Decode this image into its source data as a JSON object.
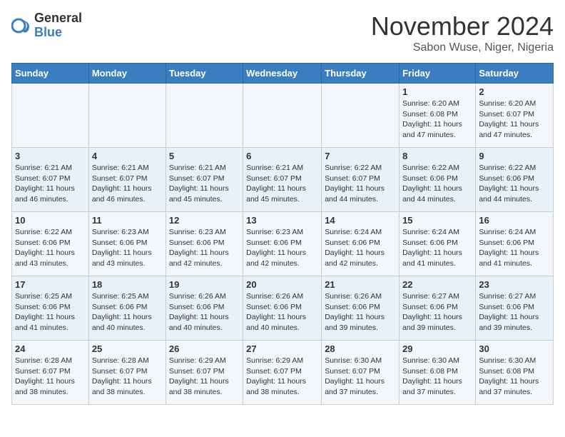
{
  "logo": {
    "general": "General",
    "blue": "Blue"
  },
  "title": "November 2024",
  "location": "Sabon Wuse, Niger, Nigeria",
  "weekdays": [
    "Sunday",
    "Monday",
    "Tuesday",
    "Wednesday",
    "Thursday",
    "Friday",
    "Saturday"
  ],
  "weeks": [
    [
      {
        "day": "",
        "info": ""
      },
      {
        "day": "",
        "info": ""
      },
      {
        "day": "",
        "info": ""
      },
      {
        "day": "",
        "info": ""
      },
      {
        "day": "",
        "info": ""
      },
      {
        "day": "1",
        "info": "Sunrise: 6:20 AM\nSunset: 6:08 PM\nDaylight: 11 hours and 47 minutes."
      },
      {
        "day": "2",
        "info": "Sunrise: 6:20 AM\nSunset: 6:07 PM\nDaylight: 11 hours and 47 minutes."
      }
    ],
    [
      {
        "day": "3",
        "info": "Sunrise: 6:21 AM\nSunset: 6:07 PM\nDaylight: 11 hours and 46 minutes."
      },
      {
        "day": "4",
        "info": "Sunrise: 6:21 AM\nSunset: 6:07 PM\nDaylight: 11 hours and 46 minutes."
      },
      {
        "day": "5",
        "info": "Sunrise: 6:21 AM\nSunset: 6:07 PM\nDaylight: 11 hours and 45 minutes."
      },
      {
        "day": "6",
        "info": "Sunrise: 6:21 AM\nSunset: 6:07 PM\nDaylight: 11 hours and 45 minutes."
      },
      {
        "day": "7",
        "info": "Sunrise: 6:22 AM\nSunset: 6:07 PM\nDaylight: 11 hours and 44 minutes."
      },
      {
        "day": "8",
        "info": "Sunrise: 6:22 AM\nSunset: 6:06 PM\nDaylight: 11 hours and 44 minutes."
      },
      {
        "day": "9",
        "info": "Sunrise: 6:22 AM\nSunset: 6:06 PM\nDaylight: 11 hours and 44 minutes."
      }
    ],
    [
      {
        "day": "10",
        "info": "Sunrise: 6:22 AM\nSunset: 6:06 PM\nDaylight: 11 hours and 43 minutes."
      },
      {
        "day": "11",
        "info": "Sunrise: 6:23 AM\nSunset: 6:06 PM\nDaylight: 11 hours and 43 minutes."
      },
      {
        "day": "12",
        "info": "Sunrise: 6:23 AM\nSunset: 6:06 PM\nDaylight: 11 hours and 42 minutes."
      },
      {
        "day": "13",
        "info": "Sunrise: 6:23 AM\nSunset: 6:06 PM\nDaylight: 11 hours and 42 minutes."
      },
      {
        "day": "14",
        "info": "Sunrise: 6:24 AM\nSunset: 6:06 PM\nDaylight: 11 hours and 42 minutes."
      },
      {
        "day": "15",
        "info": "Sunrise: 6:24 AM\nSunset: 6:06 PM\nDaylight: 11 hours and 41 minutes."
      },
      {
        "day": "16",
        "info": "Sunrise: 6:24 AM\nSunset: 6:06 PM\nDaylight: 11 hours and 41 minutes."
      }
    ],
    [
      {
        "day": "17",
        "info": "Sunrise: 6:25 AM\nSunset: 6:06 PM\nDaylight: 11 hours and 41 minutes."
      },
      {
        "day": "18",
        "info": "Sunrise: 6:25 AM\nSunset: 6:06 PM\nDaylight: 11 hours and 40 minutes."
      },
      {
        "day": "19",
        "info": "Sunrise: 6:26 AM\nSunset: 6:06 PM\nDaylight: 11 hours and 40 minutes."
      },
      {
        "day": "20",
        "info": "Sunrise: 6:26 AM\nSunset: 6:06 PM\nDaylight: 11 hours and 40 minutes."
      },
      {
        "day": "21",
        "info": "Sunrise: 6:26 AM\nSunset: 6:06 PM\nDaylight: 11 hours and 39 minutes."
      },
      {
        "day": "22",
        "info": "Sunrise: 6:27 AM\nSunset: 6:06 PM\nDaylight: 11 hours and 39 minutes."
      },
      {
        "day": "23",
        "info": "Sunrise: 6:27 AM\nSunset: 6:06 PM\nDaylight: 11 hours and 39 minutes."
      }
    ],
    [
      {
        "day": "24",
        "info": "Sunrise: 6:28 AM\nSunset: 6:07 PM\nDaylight: 11 hours and 38 minutes."
      },
      {
        "day": "25",
        "info": "Sunrise: 6:28 AM\nSunset: 6:07 PM\nDaylight: 11 hours and 38 minutes."
      },
      {
        "day": "26",
        "info": "Sunrise: 6:29 AM\nSunset: 6:07 PM\nDaylight: 11 hours and 38 minutes."
      },
      {
        "day": "27",
        "info": "Sunrise: 6:29 AM\nSunset: 6:07 PM\nDaylight: 11 hours and 38 minutes."
      },
      {
        "day": "28",
        "info": "Sunrise: 6:30 AM\nSunset: 6:07 PM\nDaylight: 11 hours and 37 minutes."
      },
      {
        "day": "29",
        "info": "Sunrise: 6:30 AM\nSunset: 6:08 PM\nDaylight: 11 hours and 37 minutes."
      },
      {
        "day": "30",
        "info": "Sunrise: 6:30 AM\nSunset: 6:08 PM\nDaylight: 11 hours and 37 minutes."
      }
    ]
  ]
}
